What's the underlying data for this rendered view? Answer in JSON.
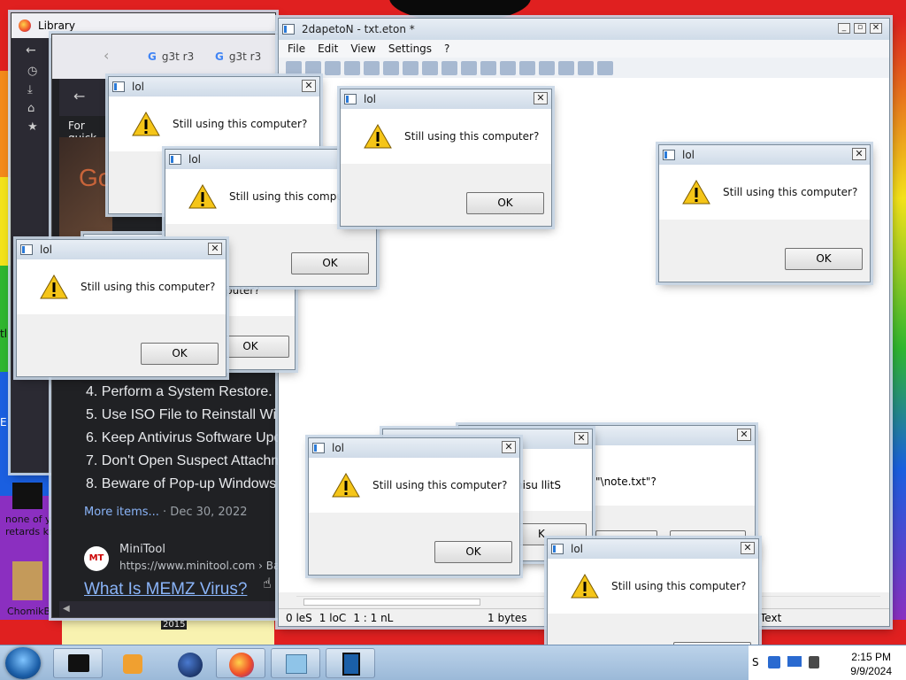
{
  "desktop": {
    "icon_labels": [
      "none of y",
      "retards kn",
      "ChomikB"
    ],
    "edge_labels": [
      "E",
      "tl"
    ]
  },
  "library": {
    "title": "Library"
  },
  "browser": {
    "tabs": [
      "g3t r3",
      "g3t r3"
    ],
    "quick_text": "For quick",
    "logo_fragment": "Go",
    "results": [
      "4. Perform a System Restore.",
      "5. Use ISO File to Reinstall Wi",
      "6. Keep Antivirus Software Upd",
      "7. Don't Open Suspect Attachm",
      "8. Beware of Pop-up Windows"
    ],
    "more_items": "More items...",
    "more_date": "· Dec 30, 2022",
    "source_badge": "MT",
    "source_name": "MiniTool",
    "source_url": "https://www.minitool.com › Backu",
    "headline": "What Is MEMZ Virus?",
    "year_label": "2015"
  },
  "notepad": {
    "title": "2dapetoN - txt.eton *",
    "menu": [
      "File",
      "Edit",
      "View",
      "Settings",
      "?"
    ],
    "status": {
      "sel": "0 leS",
      "col": "1 loC",
      "ln": "1 : 1 nL",
      "size": "1 bytes",
      "type": "Text"
    }
  },
  "save_prompt": {
    "text": "\"\\note.txt\"?"
  },
  "reversed_popup": {
    "text": "nisu llitS",
    "ok_fragment": "K"
  },
  "popup": {
    "title": "lol",
    "message": "Still using this computer?",
    "ok": "OK",
    "partial_message": "puter?"
  },
  "taskbar": {
    "time": "2:15 PM",
    "date": "9/9/2024",
    "tray_letter": "S"
  },
  "colors": {
    "accent": "#1a73e8",
    "link": "#8ab4f8",
    "dark_bg": "#1c1b22",
    "warning": "#f5c518"
  }
}
